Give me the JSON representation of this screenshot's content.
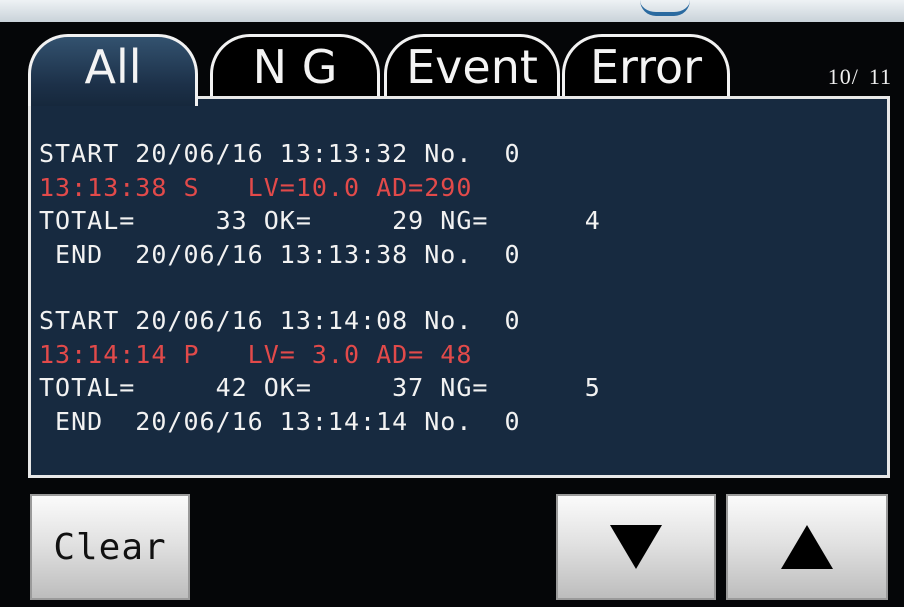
{
  "tabs": [
    {
      "label": "All",
      "active": true
    },
    {
      "label": "N G",
      "active": false
    },
    {
      "label": "Event",
      "active": false
    },
    {
      "label": "Error",
      "active": false
    }
  ],
  "page_indicator": {
    "current": "10/",
    "total": "11"
  },
  "log": {
    "block1": {
      "start": "START 20/06/16 13:13:32 No.  0",
      "value": "13:13:38 S   LV=10.0 AD=290",
      "total": "TOTAL=     33 OK=     29 NG=      4",
      "end": " END  20/06/16 13:13:38 No.  0"
    },
    "block2": {
      "start": "START 20/06/16 13:14:08 No.  0",
      "value": "13:14:14 P   LV= 3.0 AD= 48",
      "total": "TOTAL=     42 OK=     37 NG=      5",
      "end": " END  20/06/16 13:14:14 No.  0"
    }
  },
  "buttons": {
    "clear_label": "Clear",
    "down_icon": "triangle-down",
    "up_icon": "triangle-up"
  },
  "colors": {
    "panel_bg": "#172a40",
    "event_text": "#e24a4a",
    "text": "#f2f2f2"
  }
}
